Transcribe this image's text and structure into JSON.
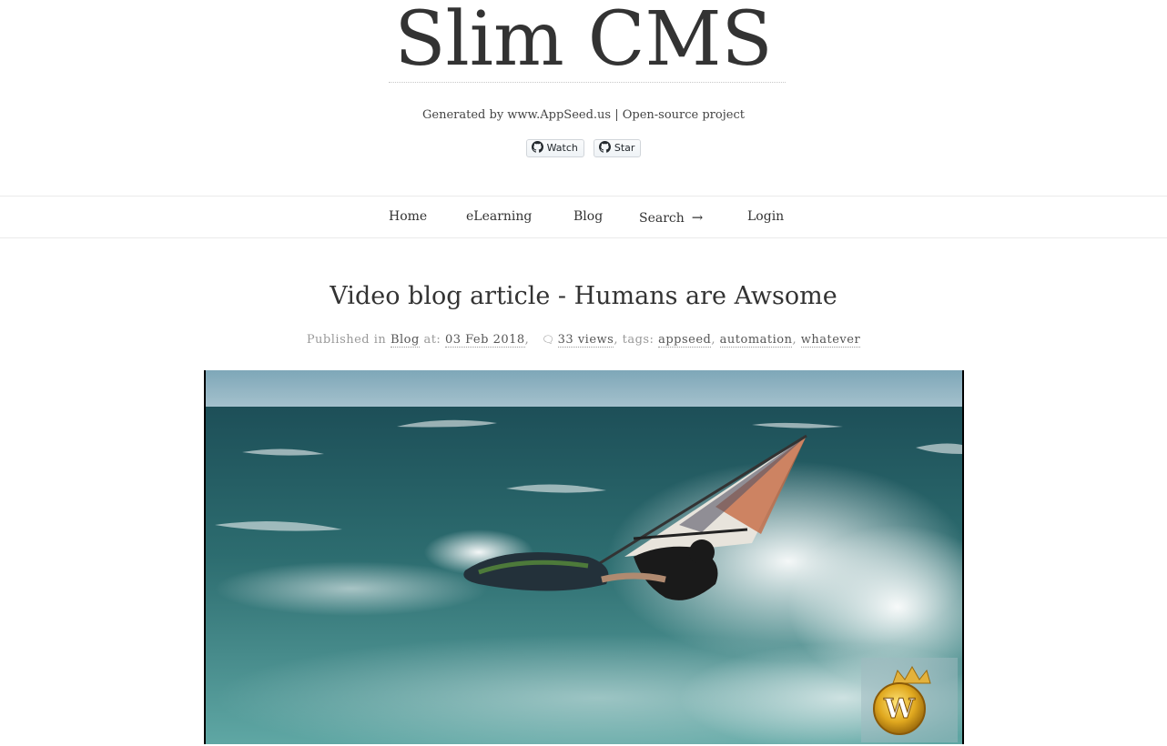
{
  "site": {
    "title": "Slim CMS",
    "tagline": "Generated by www.AppSeed.us | Open-source project",
    "github_buttons": {
      "watch": "Watch",
      "star": "Star"
    }
  },
  "nav": {
    "items": [
      {
        "label": "Home"
      },
      {
        "label": "eLearning"
      },
      {
        "label": "Blog"
      },
      {
        "label": "Search",
        "arrow": "→"
      },
      {
        "label": "Login"
      }
    ]
  },
  "article": {
    "title": "Video blog article - Humans are Awsome",
    "meta": {
      "published_in_text": "Published in",
      "category": "Blog",
      "at_text": "at:",
      "date": "03 Feb 2018",
      "views": "33 views",
      "tags_text": "tags:",
      "tags": [
        "appseed",
        "automation",
        "whatever"
      ]
    }
  },
  "video": {
    "logo_letter": "W"
  },
  "colors": {
    "text": "#333333",
    "muted": "#999999",
    "border": "#ebebeb",
    "sea": "#2e6b6f",
    "sky": "#8fb4c4"
  }
}
